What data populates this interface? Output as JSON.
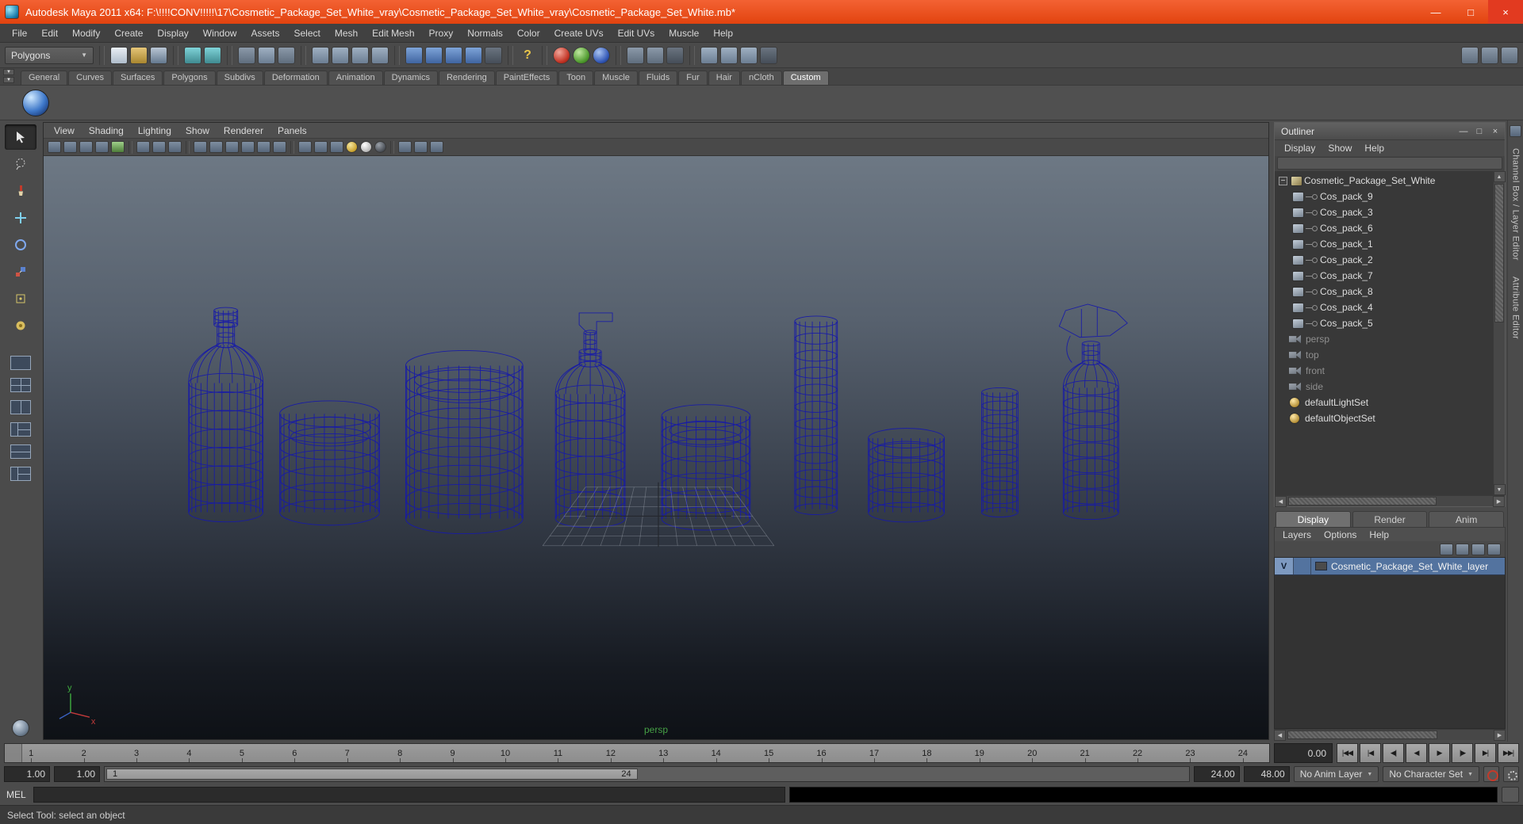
{
  "titlebar": {
    "title": "Autodesk Maya 2011 x64: F:\\!!!!CONV!!!!!\\17\\Cosmetic_Package_Set_White_vray\\Cosmetic_Package_Set_White_vray\\Cosmetic_Package_Set_White.mb*"
  },
  "icons": {
    "minimize": "—",
    "maximize": "□",
    "close": "×",
    "collapse": "−",
    "up": "▲",
    "down": "▼",
    "left": "◀",
    "right": "▶",
    "combo_arrow": "▼",
    "help": "?"
  },
  "menubar": [
    "File",
    "Edit",
    "Modify",
    "Create",
    "Display",
    "Window",
    "Assets",
    "Select",
    "Mesh",
    "Edit Mesh",
    "Proxy",
    "Normals",
    "Color",
    "Create UVs",
    "Edit UVs",
    "Muscle",
    "Help"
  ],
  "statusline": {
    "menu_set": "Polygons"
  },
  "shelf": {
    "tabs": [
      "General",
      "Curves",
      "Surfaces",
      "Polygons",
      "Subdivs",
      "Deformation",
      "Animation",
      "Dynamics",
      "Rendering",
      "PaintEffects",
      "Toon",
      "Muscle",
      "Fluids",
      "Fur",
      "Hair",
      "nCloth",
      "Custom"
    ],
    "active": "Custom"
  },
  "viewport": {
    "menus": [
      "View",
      "Shading",
      "Lighting",
      "Show",
      "Renderer",
      "Panels"
    ],
    "camera_label": "persp"
  },
  "outliner": {
    "title": "Outliner",
    "menus": [
      "Display",
      "Show",
      "Help"
    ],
    "root_label": "Cosmetic_Package_Set_White",
    "children": [
      "Cos_pack_9",
      "Cos_pack_3",
      "Cos_pack_6",
      "Cos_pack_1",
      "Cos_pack_2",
      "Cos_pack_7",
      "Cos_pack_8",
      "Cos_pack_4",
      "Cos_pack_5"
    ],
    "cameras": [
      "persp",
      "top",
      "front",
      "side"
    ],
    "sets": [
      "defaultLightSet",
      "defaultObjectSet"
    ]
  },
  "layer_editor": {
    "tabs": [
      "Display",
      "Render",
      "Anim"
    ],
    "active_tab": "Display",
    "menus": [
      "Layers",
      "Options",
      "Help"
    ],
    "layers": [
      {
        "visible": "V",
        "name": "Cosmetic_Package_Set_White_layer"
      }
    ]
  },
  "sidebar": {
    "tabs": [
      "Channel Box / Layer Editor",
      "Attribute Editor"
    ]
  },
  "timeline": {
    "frames": [
      "1",
      "2",
      "3",
      "4",
      "5",
      "6",
      "7",
      "8",
      "9",
      "10",
      "11",
      "12",
      "13",
      "14",
      "15",
      "16",
      "17",
      "18",
      "19",
      "20",
      "21",
      "22",
      "23",
      "24"
    ],
    "current_time": "0.00"
  },
  "playback": [
    {
      "name": "go-to-start",
      "glyph": "|◀◀"
    },
    {
      "name": "step-back-key",
      "glyph": "|◀"
    },
    {
      "name": "step-back-frame",
      "glyph": "◀|"
    },
    {
      "name": "play-backward",
      "glyph": "◀"
    },
    {
      "name": "play-forward",
      "glyph": "▶"
    },
    {
      "name": "step-forward-frame",
      "glyph": "|▶"
    },
    {
      "name": "step-forward-key",
      "glyph": "▶|"
    },
    {
      "name": "go-to-end",
      "glyph": "▶▶|"
    }
  ],
  "range_slider": {
    "anim_start": "1.00",
    "play_start": "1.00",
    "inner_start": "1",
    "inner_end": "24",
    "play_end": "24.00",
    "anim_end": "48.00",
    "anim_layer": "No Anim Layer",
    "character_set": "No Character Set"
  },
  "command_line": {
    "label": "MEL"
  },
  "help_line": {
    "text": "Select Tool: select an object"
  },
  "colors": {
    "titlebar": "#e94e1d",
    "selection": "#53739f",
    "wireframe": "#171aa8",
    "viewport_top": "#6d7884",
    "viewport_bottom": "#0e1116"
  }
}
